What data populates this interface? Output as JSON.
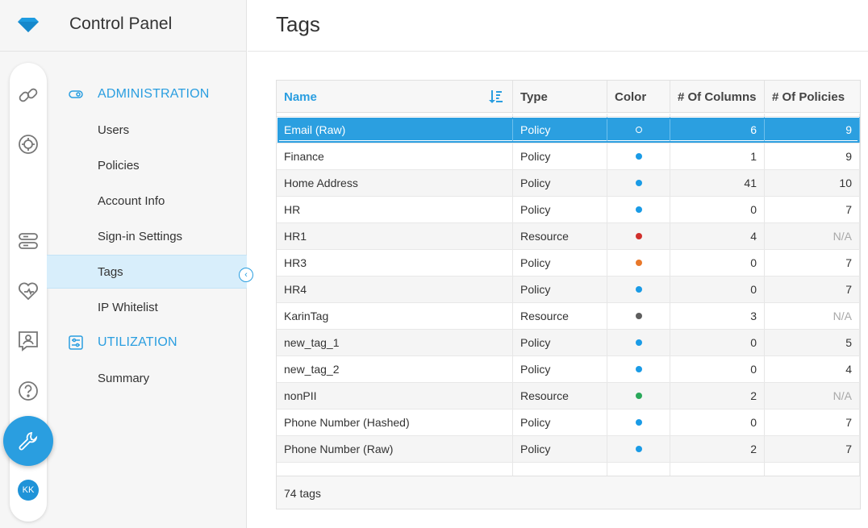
{
  "app": {
    "title": "Control Panel"
  },
  "page": {
    "title": "Tags"
  },
  "sidebar": {
    "sections": [
      {
        "label": "ADMINISTRATION",
        "icon": "toggle-icon"
      },
      {
        "label": "UTILIZATION",
        "icon": "sliders-icon"
      }
    ],
    "items": [
      {
        "label": "Users"
      },
      {
        "label": "Policies"
      },
      {
        "label": "Account Info"
      },
      {
        "label": "Sign-in Settings"
      },
      {
        "label": "Tags",
        "active": true
      },
      {
        "label": "IP Whitelist"
      },
      {
        "label": "Summary"
      }
    ]
  },
  "rail": {
    "icons": [
      "link-icon",
      "gear-cycle-icon",
      "database-icon",
      "heart-icon",
      "contact-icon",
      "help-icon",
      "wrench-icon"
    ],
    "avatar_initials": "KK"
  },
  "table": {
    "columns": [
      "Name",
      "Type",
      "Color",
      "# Of Columns",
      "# Of Policies"
    ],
    "rows": [
      {
        "name": "",
        "type": "",
        "color": "",
        "columns": "",
        "policies": ""
      },
      {
        "name": "Email (Raw)",
        "type": "Policy",
        "color": "#ffffff",
        "columns": "6",
        "policies": "9",
        "selected": true
      },
      {
        "name": "Finance",
        "type": "Policy",
        "color": "#1a9be6",
        "columns": "1",
        "policies": "9"
      },
      {
        "name": "Home Address",
        "type": "Policy",
        "color": "#1a9be6",
        "columns": "41",
        "policies": "10"
      },
      {
        "name": "HR",
        "type": "Policy",
        "color": "#1a9be6",
        "columns": "0",
        "policies": "7"
      },
      {
        "name": "HR1",
        "type": "Resource",
        "color": "#d0302c",
        "columns": "4",
        "policies": "N/A"
      },
      {
        "name": "HR3",
        "type": "Policy",
        "color": "#e8782a",
        "columns": "0",
        "policies": "7"
      },
      {
        "name": "HR4",
        "type": "Policy",
        "color": "#1a9be6",
        "columns": "0",
        "policies": "7"
      },
      {
        "name": "KarinTag",
        "type": "Resource",
        "color": "#5e5e5e",
        "columns": "3",
        "policies": "N/A"
      },
      {
        "name": "new_tag_1",
        "type": "Policy",
        "color": "#1a9be6",
        "columns": "0",
        "policies": "5"
      },
      {
        "name": "new_tag_2",
        "type": "Policy",
        "color": "#1a9be6",
        "columns": "0",
        "policies": "4"
      },
      {
        "name": "nonPII",
        "type": "Resource",
        "color": "#2aa85a",
        "columns": "2",
        "policies": "N/A"
      },
      {
        "name": "Phone Number (Hashed)",
        "type": "Policy",
        "color": "#1a9be6",
        "columns": "0",
        "policies": "7"
      },
      {
        "name": "Phone Number (Raw)",
        "type": "Policy",
        "color": "#1a9be6",
        "columns": "2",
        "policies": "7"
      },
      {
        "name": "",
        "type": "",
        "color": "",
        "columns": "",
        "policies": ""
      }
    ],
    "footer": "74 tags"
  },
  "colors": {
    "accent": "#2a9ee0"
  }
}
